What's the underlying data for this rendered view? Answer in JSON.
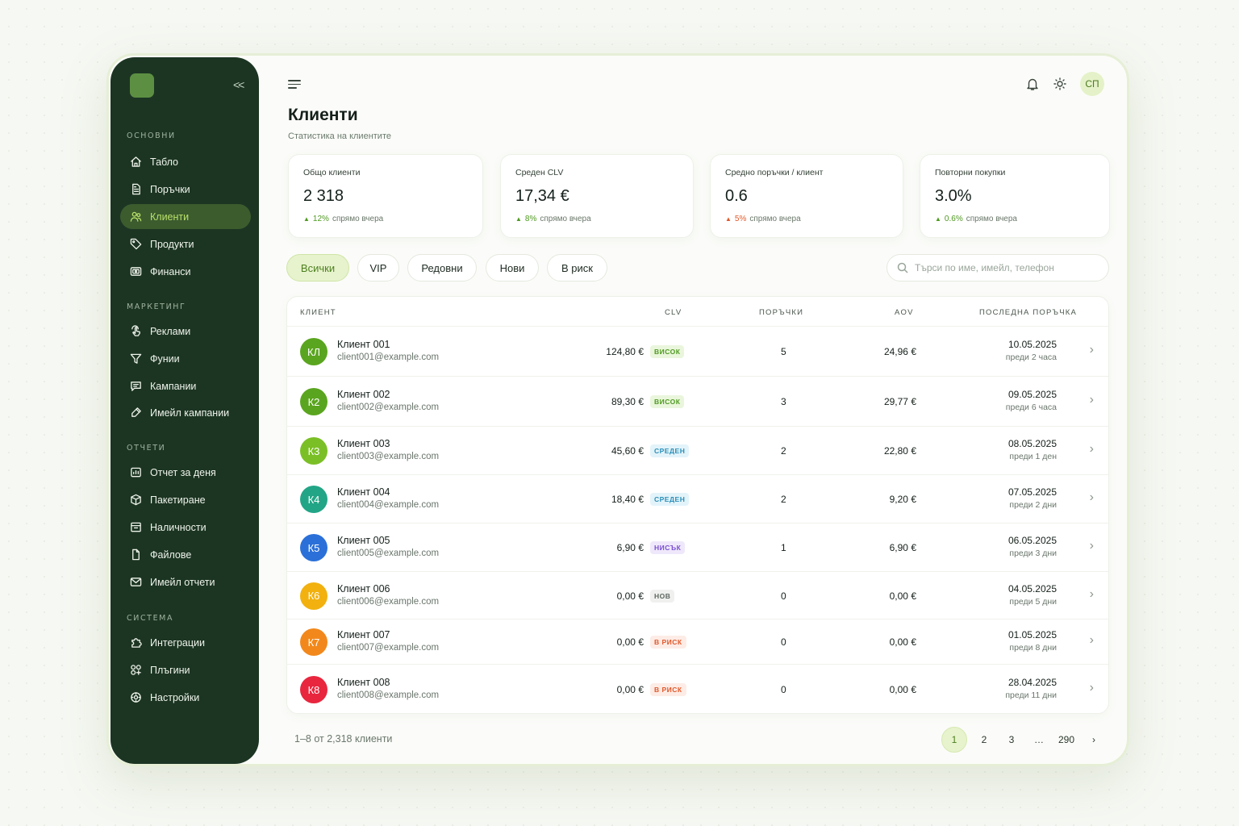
{
  "sidebar": {
    "sections": [
      {
        "title": "ОСНОВНИ"
      },
      {
        "title": "МАРКЕТИНГ"
      },
      {
        "title": "ОТЧЕТИ"
      },
      {
        "title": "СИСТЕМА"
      }
    ],
    "items": [
      {
        "label": "Табло",
        "icon": "home-icon"
      },
      {
        "label": "Поръчки",
        "icon": "document-icon"
      },
      {
        "label": "Клиенти",
        "icon": "users-icon"
      },
      {
        "label": "Продукти",
        "icon": "tag-icon"
      },
      {
        "label": "Финанси",
        "icon": "wallet-icon"
      },
      {
        "label": "Реклами",
        "icon": "touch-icon"
      },
      {
        "label": "Фунии",
        "icon": "funnel-icon"
      },
      {
        "label": "Кампании",
        "icon": "message-icon"
      },
      {
        "label": "Имейл кампании",
        "icon": "send-icon"
      },
      {
        "label": "Отчет за деня",
        "icon": "report-icon"
      },
      {
        "label": "Пакетиране",
        "icon": "package-icon"
      },
      {
        "label": "Наличности",
        "icon": "inventory-icon"
      },
      {
        "label": "Файлове",
        "icon": "file-icon"
      },
      {
        "label": "Имейл отчети",
        "icon": "mail-icon"
      },
      {
        "label": "Интеграции",
        "icon": "puzzle-icon"
      },
      {
        "label": "Плъгини",
        "icon": "plugin-icon"
      },
      {
        "label": "Настройки",
        "icon": "settings-icon"
      }
    ]
  },
  "header": {
    "avatar": "СП"
  },
  "page": {
    "title": "Клиенти",
    "subtitle": "Статистика на клиентите"
  },
  "stats": [
    {
      "label": "Общо клиенти",
      "value": "2 318",
      "pct": "12%",
      "suffix": "спрямо вчера"
    },
    {
      "label": "Среден CLV",
      "value": "17,34 €",
      "pct": "8%",
      "suffix": "спрямо вчера"
    },
    {
      "label": "Средно поръчки / клиент",
      "value": "0.6",
      "pct": "5%",
      "suffix": "спрямо вчера"
    },
    {
      "label": "Повторни покупки",
      "value": "3.0%",
      "pct": "0.6%",
      "suffix": "спрямо вчера"
    }
  ],
  "filters": [
    "Всички",
    "VIP",
    "Редовни",
    "Нови",
    "В риск"
  ],
  "search": {
    "placeholder": "Търси по име, имейл, телефон"
  },
  "table": {
    "headers": {
      "client": "КЛИЕНТ",
      "clv": "CLV",
      "orders": "ПОРЪЧКИ",
      "aov": "AOV",
      "last": "ПОСЛЕДНА ПОРЪЧКА"
    },
    "rows": [
      {
        "initials": "КЛ",
        "name": "Клиент 001",
        "email": "client001@example.com",
        "clv": "124,80 €",
        "badge": "ВИСОК",
        "orders": "5",
        "aov": "24,96 €",
        "date": "10.05.2025",
        "ago": "преди 2 часа"
      },
      {
        "initials": "К2",
        "name": "Клиент 002",
        "email": "client002@example.com",
        "clv": "89,30 €",
        "badge": "ВИСОК",
        "orders": "3",
        "aov": "29,77 €",
        "date": "09.05.2025",
        "ago": "преди 6 часа"
      },
      {
        "initials": "К3",
        "name": "Клиент 003",
        "email": "client003@example.com",
        "clv": "45,60 €",
        "badge": "СРЕДЕН",
        "orders": "2",
        "aov": "22,80 €",
        "date": "08.05.2025",
        "ago": "преди 1 ден"
      },
      {
        "initials": "К4",
        "name": "Клиент 004",
        "email": "client004@example.com",
        "clv": "18,40 €",
        "badge": "СРЕДЕН",
        "orders": "2",
        "aov": "9,20 €",
        "date": "07.05.2025",
        "ago": "преди 2 дни"
      },
      {
        "initials": "К5",
        "name": "Клиент 005",
        "email": "client005@example.com",
        "clv": "6,90 €",
        "badge": "НИСЪК",
        "orders": "1",
        "aov": "6,90 €",
        "date": "06.05.2025",
        "ago": "преди 3 дни"
      },
      {
        "initials": "К6",
        "name": "Клиент 006",
        "email": "client006@example.com",
        "clv": "0,00 €",
        "badge": "НОВ",
        "orders": "0",
        "aov": "0,00 €",
        "date": "04.05.2025",
        "ago": "преди 5 дни"
      },
      {
        "initials": "К7",
        "name": "Клиент 007",
        "email": "client007@example.com",
        "clv": "0,00 €",
        "badge": "В РИСК",
        "orders": "0",
        "aov": "0,00 €",
        "date": "01.05.2025",
        "ago": "преди 8 дни"
      },
      {
        "initials": "К8",
        "name": "Клиент 008",
        "email": "client008@example.com",
        "clv": "0,00 €",
        "badge": "В РИСК",
        "orders": "0",
        "aov": "0,00 €",
        "date": "28.04.2025",
        "ago": "преди 11 дни"
      }
    ]
  },
  "footer": {
    "count": "1–8 от 2,318 клиенти"
  },
  "pagination": {
    "pages": [
      "1",
      "2",
      "3",
      "…",
      "290"
    ]
  },
  "colors": {
    "sidebar": "#1c3523",
    "accent": "#b9e06a",
    "badge_high": "#4f9a21",
    "badge_mid": "#2a8fb8",
    "badge_low": "#7a4fd0",
    "badge_risk": "#e1592b"
  }
}
